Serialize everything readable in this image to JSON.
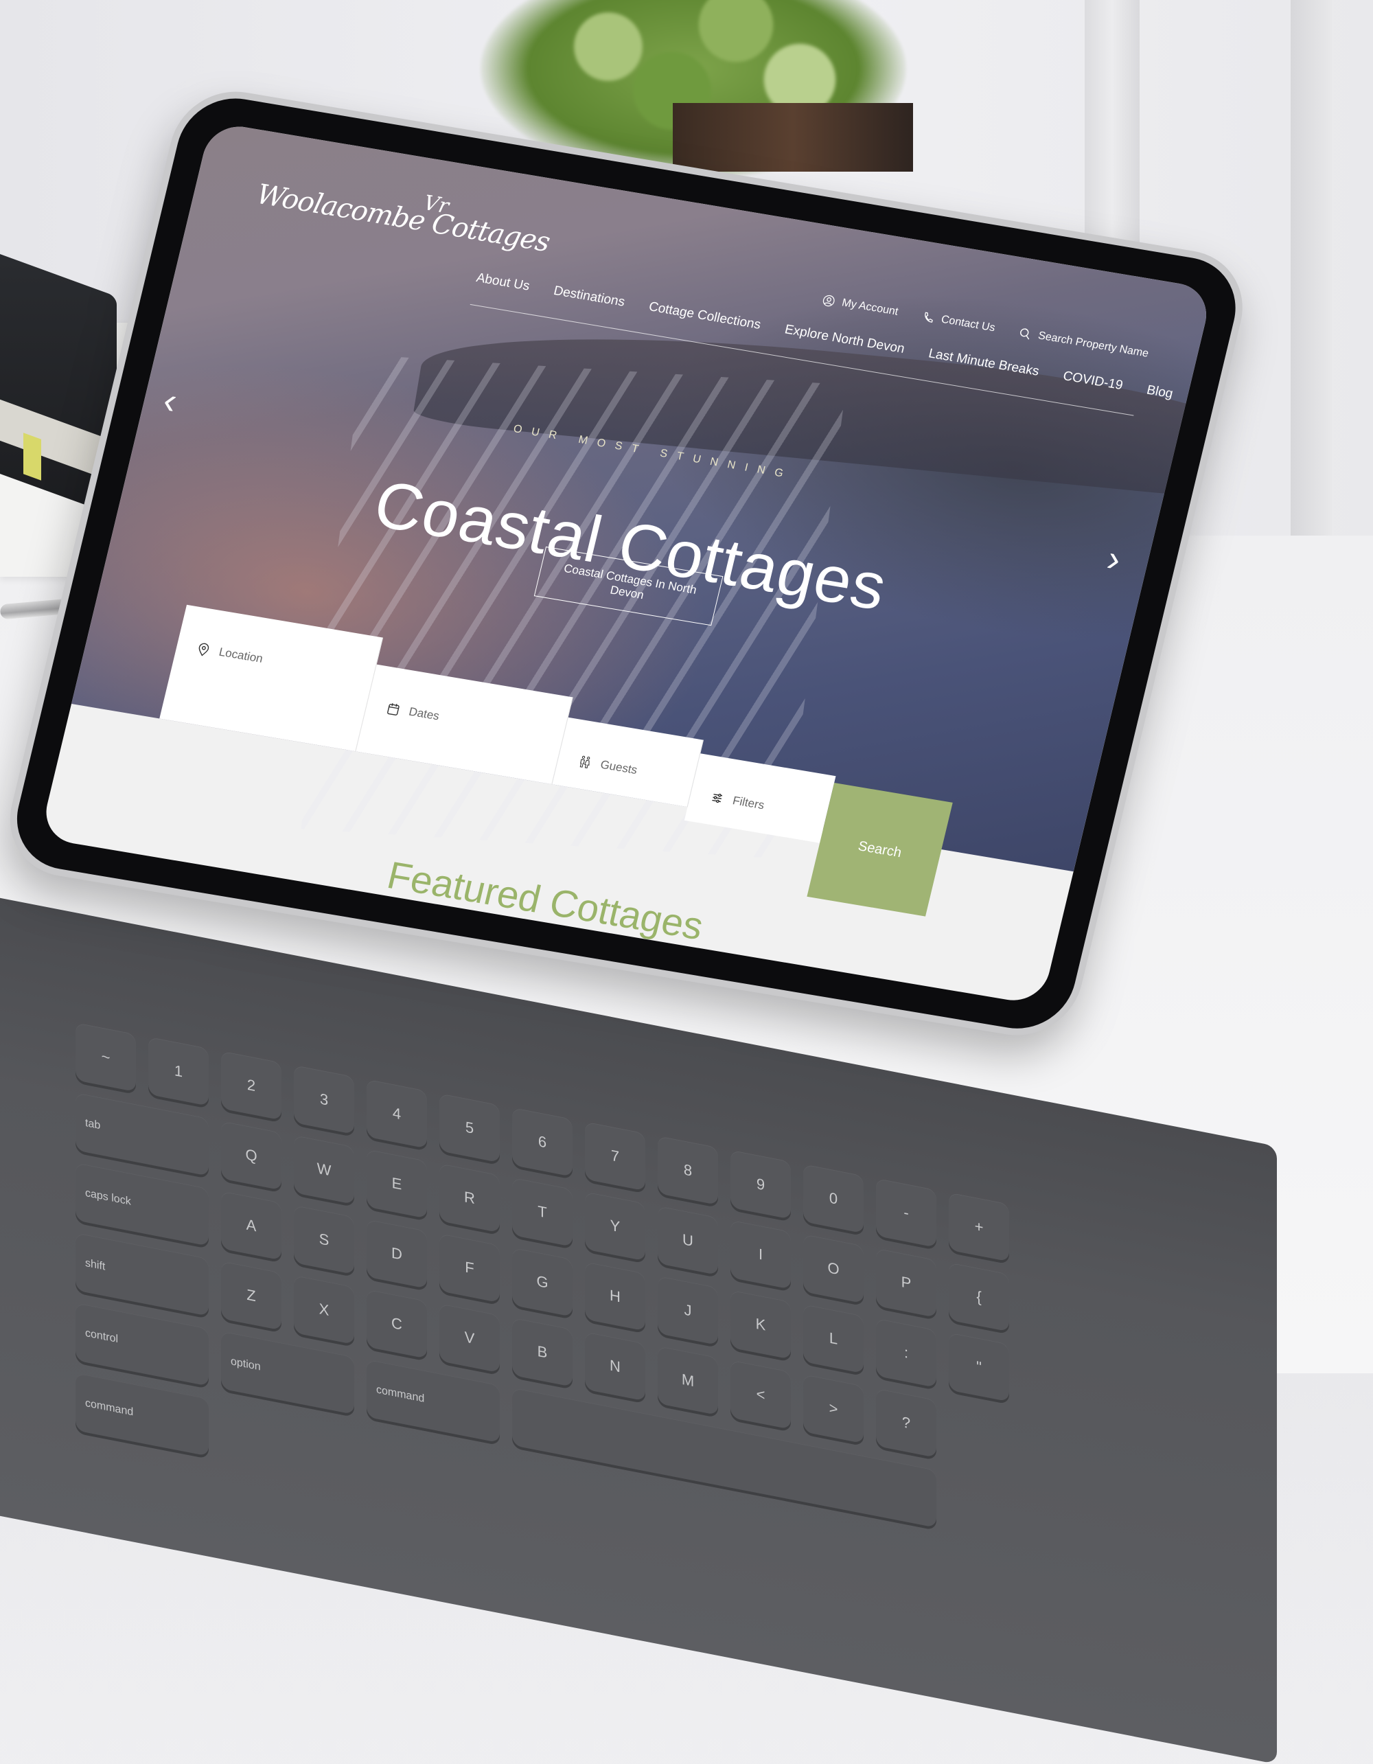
{
  "site": {
    "logo_text": "Woolacombe Cottages",
    "logo_mark": "Vr"
  },
  "topbar": {
    "items": [
      {
        "label": "My Account",
        "icon": "user-circle-icon"
      },
      {
        "label": "Contact Us",
        "icon": "phone-icon"
      },
      {
        "label": "Search Property Name",
        "icon": "search-icon"
      }
    ]
  },
  "nav": {
    "items": [
      {
        "label": "About Us"
      },
      {
        "label": "Destinations"
      },
      {
        "label": "Cottage Collections"
      },
      {
        "label": "Explore North Devon"
      },
      {
        "label": "Last Minute Breaks"
      },
      {
        "label": "COVID-19"
      },
      {
        "label": "Blog"
      }
    ]
  },
  "hero": {
    "eyebrow": "OUR MOST STUNNING",
    "title": "Coastal Cottages",
    "cta_label": "Coastal Cottages In North Devon",
    "prev_arrow": "‹",
    "next_arrow": "›"
  },
  "search": {
    "location_placeholder": "Location",
    "dates_placeholder": "Dates",
    "guests_placeholder": "Guests",
    "filters_label": "Filters",
    "button_label": "Search"
  },
  "featured": {
    "heading": "Featured Cottages"
  },
  "colors": {
    "accent_green": "#a0b474",
    "heading_green": "#9ab46a"
  },
  "keyboard": {
    "keys": [
      "~",
      "1",
      "2",
      "3",
      "4",
      "5",
      "6",
      "7",
      "8",
      "9",
      "0",
      "-",
      "+",
      "tab",
      "Q",
      "W",
      "E",
      "R",
      "T",
      "Y",
      "U",
      "I",
      "O",
      "P",
      "{",
      "caps lock",
      "A",
      "S",
      "D",
      "F",
      "G",
      "H",
      "J",
      "K",
      "L",
      ":",
      "\"",
      "shift",
      "Z",
      "X",
      "C",
      "V",
      "B",
      "N",
      "M",
      "<",
      ">",
      "?",
      "control",
      "option",
      "command",
      "",
      "command"
    ]
  }
}
